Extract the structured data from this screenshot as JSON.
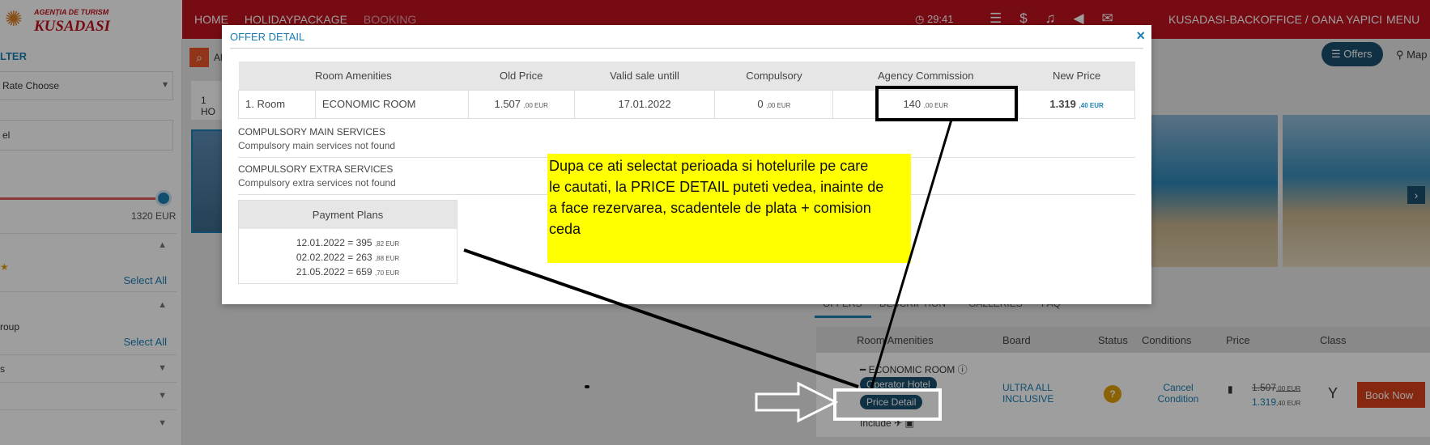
{
  "logo": {
    "small": "AGENȚIA DE TURISM",
    "big": "KUSADASI"
  },
  "breadcrumbs": [
    "HOME",
    "HOLIDAYPACKAGE",
    "BOOKING"
  ],
  "topbar": {
    "time": "29:41",
    "user": "KUSADASI-BACKOFFICE / OANA YAPICI",
    "menu": "MENU"
  },
  "sidebar": {
    "filter": "LTER",
    "rate_choose": "Rate Choose",
    "input_value": "el",
    "price_max": "1320 EUR",
    "select_all_1": "Select All",
    "group_label": "roup",
    "select_all_2": "Select All",
    "row_s": "s"
  },
  "search_partial": "Al",
  "offers_button": "Offers",
  "map_button": "Map",
  "hotel_tab": "1 HO",
  "tabs": [
    "OFFERS",
    "DESCRIPTION",
    "GALLERIES",
    "FAQ"
  ],
  "offer_table": {
    "headers": [
      "Room Amenities",
      "Board",
      "Status",
      "Conditions",
      "Price",
      "Class"
    ],
    "room": "ECONOMIC ROOM",
    "operator_badge": "Operator Hotel",
    "price_detail": "Price Detail",
    "include": "Include",
    "board": "ULTRA ALL INCLUSIVE",
    "conditions": "Cancel Condition",
    "old_price": "1.507",
    "old_cents": ",00 EUR",
    "new_price": "1.319",
    "new_cents": ",40 EUR",
    "class": "Y",
    "book_now": "Book Now"
  },
  "modal": {
    "title": "OFFER DETAIL",
    "close": "×",
    "headers": [
      "Room Amenities",
      "Old Price",
      "Valid sale untill",
      "Compulsory",
      "Agency Commission",
      "New Price"
    ],
    "row": {
      "index": "1. Room",
      "room": "ECONOMIC ROOM",
      "old_price": "1.507",
      "old_cents": ",00 EUR",
      "valid": "17.01.2022",
      "compulsory": "0",
      "compulsory_cents": ",00 EUR",
      "commission": "140",
      "commission_cents": ",00 EUR",
      "new_price": "1.319",
      "new_cents": ",40 EUR"
    },
    "main_services_title": "COMPULSORY MAIN SERVICES",
    "main_services_text": "Compulsory main services not found",
    "extra_services_title": "COMPULSORY EXTRA SERVICES",
    "extra_services_text": "Compulsory extra services not found",
    "payment_plans_title": "Payment Plans",
    "payment_plans": [
      {
        "date": "12.01.2022 = 395",
        "cents": ",82 EUR"
      },
      {
        "date": "02.02.2022 = 263",
        "cents": ",88 EUR"
      },
      {
        "date": "21.05.2022 = 659",
        "cents": ",70 EUR"
      }
    ]
  },
  "annotation_note": {
    "lines": [
      " Dupa ce ati selectat perioada si hotelurile pe care",
      "le cautati, la PRICE DETAIL  puteti  vedea, inainte de",
      "a face rezervarea, scadentele de plata   + comision",
      "ceda"
    ],
    "color": "#ffff00"
  },
  "colors": {
    "brand_red": "#c1121f",
    "accent_blue": "#1a7fb4",
    "book_orange": "#d9421a"
  }
}
